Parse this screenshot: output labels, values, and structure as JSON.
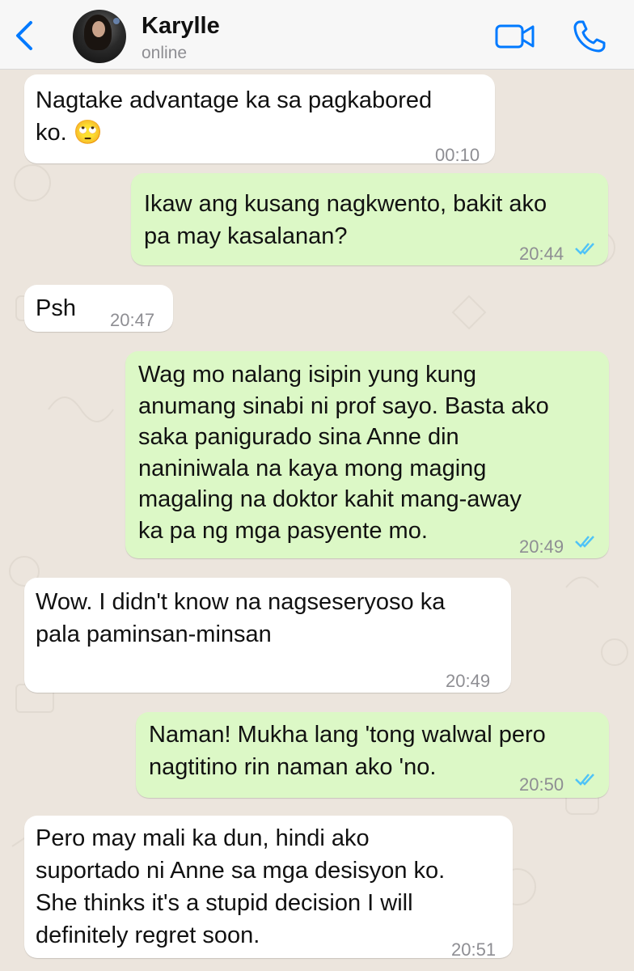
{
  "header": {
    "contact_name": "Karylle",
    "contact_status": "online",
    "icons": [
      "back-chevron-icon",
      "avatar",
      "video-call-icon",
      "phone-call-icon"
    ]
  },
  "messages": [
    {
      "direction": "in",
      "lines": [
        "Nagtake advantage ka sa pagkabored",
        "ko. 🙄"
      ],
      "time": "00:10"
    },
    {
      "direction": "out",
      "lines": [
        "Ikaw ang kusang nagkwento, bakit ako",
        "pa may kasalanan?"
      ],
      "time": "20:44",
      "read": true
    },
    {
      "direction": "in",
      "lines": [
        "Psh"
      ],
      "time": "20:47"
    },
    {
      "direction": "out",
      "lines": [
        "Wag mo nalang isipin yung kung",
        "anumang sinabi ni prof sayo. Basta ako",
        "saka panigurado sina Anne din",
        "naniniwala na kaya mong maging",
        "magaling na doktor kahit mang-away",
        "ka pa ng mga pasyente mo."
      ],
      "time": "20:49",
      "read": true
    },
    {
      "direction": "in",
      "lines": [
        "Wow. I didn't know na nagseseryoso ka",
        "pala paminsan-minsan"
      ],
      "time": "20:49"
    },
    {
      "direction": "out",
      "lines": [
        "Naman! Mukha lang 'tong walwal pero",
        "nagtitino rin naman ako 'no."
      ],
      "time": "20:50",
      "read": true
    },
    {
      "direction": "in",
      "lines": [
        "Pero may mali ka dun, hindi ako",
        "suportado ni Anne sa mga desisyon ko.",
        "She thinks it's a stupid decision I will",
        "definitely regret soon."
      ],
      "time": "20:51"
    }
  ],
  "colors": {
    "accent": "#007aff",
    "incoming_bubble": "#ffffff",
    "outgoing_bubble": "#dcf8c6",
    "chat_background": "#ece5dd",
    "read_ticks": "#4fc3f7"
  }
}
